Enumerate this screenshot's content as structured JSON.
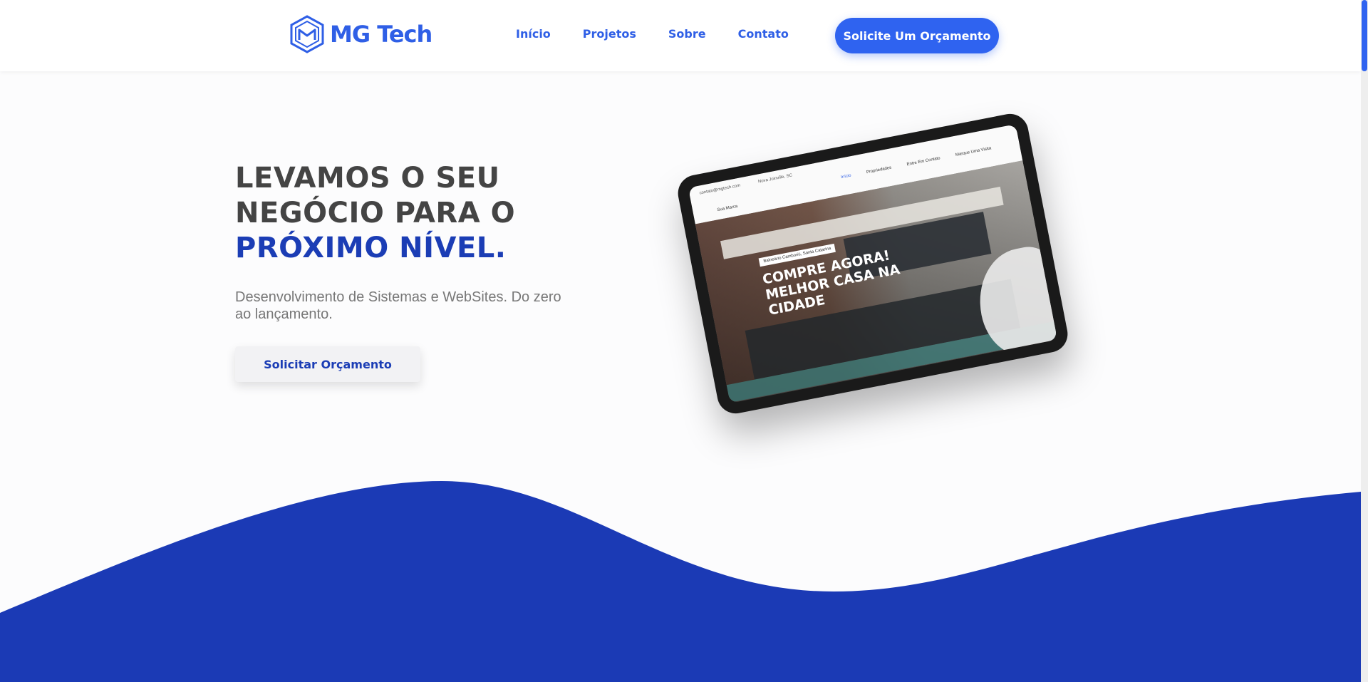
{
  "brand": {
    "name": "MG Tech",
    "color": "#2f5fe6"
  },
  "nav": {
    "items": [
      {
        "label": "Início"
      },
      {
        "label": "Projetos"
      },
      {
        "label": "Sobre"
      },
      {
        "label": "Contato"
      }
    ],
    "cta_label": "Solicite Um Orçamento"
  },
  "hero": {
    "title_line1": "LEVAMOS O SEU",
    "title_line2": "NEGÓCIO PARA O",
    "title_accent": "PRÓXIMO NÍVEL.",
    "subtitle": "Desenvolvimento de Sistemas e WebSites. Do zero ao lançamento.",
    "button_label": "Solicitar Orçamento",
    "accent_color": "#1b3db5"
  },
  "tablet_mock": {
    "email": "contato@mgtech.com",
    "location": "Nova Joinville, SC",
    "brand": "Sua Marca",
    "links": [
      "Início",
      "Propriedades",
      "Entre Em Contato",
      "Marque Uma Visita"
    ],
    "badge": "Balneário Camboriú, Santa Catarina",
    "headline": "COMPRE AGORA! MELHOR CASA NA CIDADE"
  },
  "colors": {
    "wave": "#1b3ab5",
    "primary": "#2f63f0"
  }
}
